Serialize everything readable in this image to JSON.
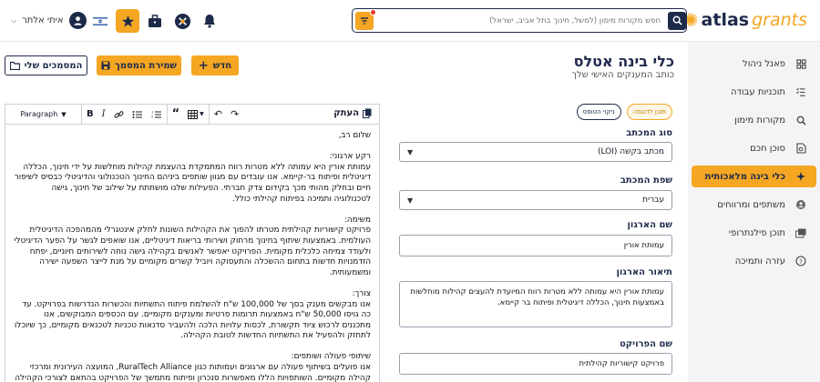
{
  "logo": {
    "a1": "atlas",
    "a2": "grants"
  },
  "user": {
    "name": "איתי אלתר"
  },
  "search": {
    "placeholder": "חפש מקורות מימון (למשל, חינוך בתל אביב, ישראל)"
  },
  "sidebar": {
    "items": [
      {
        "label": "פאנל ניהול",
        "icon": "dashboard-icon"
      },
      {
        "label": "תוכניות עבודה",
        "icon": "checklist-icon"
      },
      {
        "label": "מקורות מימון",
        "icon": "search-icon"
      },
      {
        "label": "סוכן חכם",
        "icon": "document-search-icon"
      },
      {
        "label": "כלי בינה מלאכותית",
        "icon": "sparkle-icon"
      },
      {
        "label": "משתפים ומרווחים",
        "icon": "partners-icon"
      },
      {
        "label": "תוכן פילנתרופי",
        "icon": "gallery-icon"
      },
      {
        "label": "עזרה ותמיכה",
        "icon": "help-icon"
      }
    ]
  },
  "page": {
    "title": "כלי בינה אטלס",
    "subtitle": "כותב המענקים האישי שלך"
  },
  "buttons": {
    "new": "חדש",
    "save": "שמירת המסמך",
    "docs": "המסמכים שלי"
  },
  "editor": {
    "copy_label": "העתק",
    "paragraph": "Paragraph",
    "content": "שלום רב,\n\nרקע ארגוני:\nעמותת אורין היא עמותה ללא מטרות רווח המתמקדת בהעצמת קהילות מוחלשות על ידי חינוך, הכללה דיגיטלית ופיתוח בר-קיימא. אנו עובדים עם מגוון שותפים ביניהם החינוך הטכנולוגי והדיגיטלי כבסיס לשיפור חיים ובחלק מהותי מכך בקידום צדק חברתי. הפעילות שלנו מושתתת על שילוב של חינוך, גישה לטכנולוגיה ותמיכה בפיתוח קהילתי כולל.\n\nמשימה:\nפרויקט קישוריות קהילתית מטרתו להפוך את הקהילות השונות לחלק אינטגרלי מהמהפכה הדיגיטלית העולמית. באמצעות שיתוף בחינוך מרחוק ושירותי בריאות דיגיטליים, אנו שואפים לגשר על הפער הדיגיטלי ולעודד צמיחה כלכלית מקומית. הפרויקט יאפשר לאנשים בקהילה גישה נוחה לשירותים חיוניים, יפתח הזדמנויות חדשות בתחום ההשכלה והתעסוקה ויוביל קשרים מקומיים על מנת לייצר השפעה ישירה ומשמעותית.\n\nצורך:\nאנו מבקשים מענק בסך של 100,000 ש\"ח להשלמת פיתוח התשתיות והכשרות הנדרשות בפרויקט. עד כה גויסו 50,000 ש\"ח באמצעות תרומות פרטיות ומענקים מקומיים. עם הכספים המבוקשים, אנו מתכננים לרכוש ציוד תקשורת, לכסות עלויות הלכה ולהעביר סדנאות טכניות לטכנאים מקומיים, כך שיוכלו לתחזק ולהפעיל את התשתיות החדשות לטובת הקהילה.\n\nשיתופי פעולה ושותפים:\nאנו פועלים בשיתוף פעולה עם ארגונים ועמותות כגון RuralTech Alliance, המועצה העירונית ומרכזי קהילה מקומיים. השותפויות הללו מאפשרות סנכרון ופיתוח מתמשך של הפרויקט בהתאם לצורכי הקהילה המקומית ולהבטיח השתלבות מוצלחת של הפתרונות הדיגיטליים בתוכה."
  },
  "form": {
    "tags": [
      "תוכן לדוגמה",
      "ניקוי הטופס"
    ],
    "letter_type_label": "סוג המכתב",
    "letter_type_value": "מכתב בקשה (LOI)",
    "language_label": "שפת המכתב",
    "language_value": "עברית",
    "org_name_label": "שם הארגון",
    "org_name_value": "עמותת אורין",
    "org_desc_label": "תיאור הארגון",
    "org_desc_value": "עמותת אורין היא עמותה ללא מטרות רווח המיועדת להעצים קהילות מוחלשות באמצעות חינוך, הכללה דיגיטלית ופיתוח בר קיימא.",
    "project_name_label": "שם הפרויקט",
    "project_name_value": "פרויקט קישוריות קהילתית"
  },
  "colors": {
    "accent": "#f5a623",
    "navy": "#1e2a4a"
  }
}
